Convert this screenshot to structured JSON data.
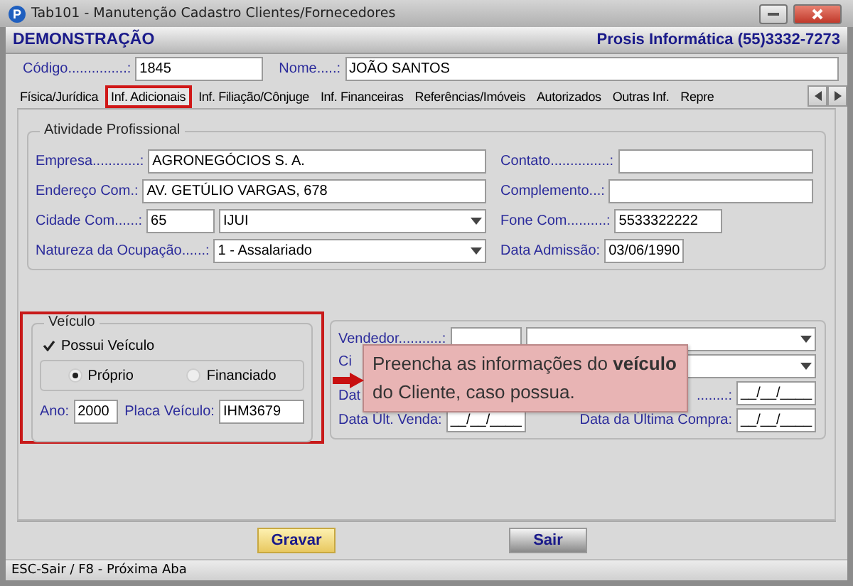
{
  "window": {
    "icon_letter": "P",
    "title": "Tab101 - Manutenção Cadastro Clientes/Fornecedores"
  },
  "header": {
    "company": "DEMONSTRAÇÃO",
    "vendor": "Prosis Informática (55)3332-7273"
  },
  "top_fields": [
    {
      "label": "Código...............:",
      "value": "1845"
    },
    {
      "label": "Nome.....:",
      "value": "JOÃO SANTOS"
    }
  ],
  "tabs": [
    {
      "label": "Física/Jurídica",
      "selected": false,
      "highlighted": false
    },
    {
      "label": "Inf. Adicionais",
      "selected": true,
      "highlighted": true
    },
    {
      "label": "Inf. Filiação/Cônjuge",
      "selected": false,
      "highlighted": false
    },
    {
      "label": "Inf. Financeiras",
      "selected": false,
      "highlighted": false
    },
    {
      "label": "Referências/Imóveis",
      "selected": false,
      "highlighted": false
    },
    {
      "label": "Autorizados",
      "selected": false,
      "highlighted": false
    },
    {
      "label": "Outras Inf.",
      "selected": false,
      "highlighted": false
    },
    {
      "label": "Repre",
      "selected": false,
      "highlighted": false
    }
  ],
  "professional": {
    "title": "Atividade Profissional",
    "left": [
      {
        "kind": "text",
        "label": "Empresa............:",
        "value": "AGRONEGÓCIOS S. A."
      },
      {
        "kind": "text",
        "label": "Endereço Com.:",
        "value": "AV. GETÚLIO VARGAS, 678"
      },
      {
        "kind": "code_combo",
        "label": "Cidade Com......:",
        "code": "65",
        "value": "IJUI"
      },
      {
        "kind": "combo",
        "label": "Natureza da  Ocupação......:",
        "value": "1 - Assalariado"
      }
    ],
    "right": [
      {
        "kind": "text",
        "label": "Contato...............:"
      },
      {
        "kind": "text",
        "label": "Complemento...:"
      },
      {
        "kind": "short",
        "label": "Fone Com..........:",
        "value": "5533322222"
      },
      {
        "kind": "date",
        "label": "Data Admissão:",
        "value": "03/06/1990"
      }
    ]
  },
  "vehicle": {
    "title": "Veículo",
    "highlighted": true,
    "owns": {
      "label": "Possui Veículo",
      "checked": true
    },
    "ownership": [
      {
        "label": "Próprio",
        "selected": true
      },
      {
        "label": "Financiado",
        "selected": false
      }
    ],
    "year": {
      "label": "Ano:",
      "value": "2000"
    },
    "plate": {
      "label": "Placa Veículo:",
      "value": "IHM3679"
    }
  },
  "sales": {
    "rows": [
      {
        "label": "Vendedor...........:"
      },
      {
        "label": "Ci"
      },
      {
        "label": "Dat",
        "right_label": "........:",
        "right_value": "__/__/____"
      },
      {
        "label": "Data Últ. Venda:",
        "value": "__/__/____",
        "right_label": "Data da Última Compra:",
        "right_value": "__/__/____"
      }
    ]
  },
  "tooltip": {
    "text": "Preencha as informações do **veículo** do Cliente, caso possua."
  },
  "buttons": [
    {
      "label": "Gravar",
      "kind": "primary"
    },
    {
      "label": "Sair",
      "kind": "secondary"
    }
  ],
  "status_bar": "ESC-Sair / F8 - Próxima Aba"
}
